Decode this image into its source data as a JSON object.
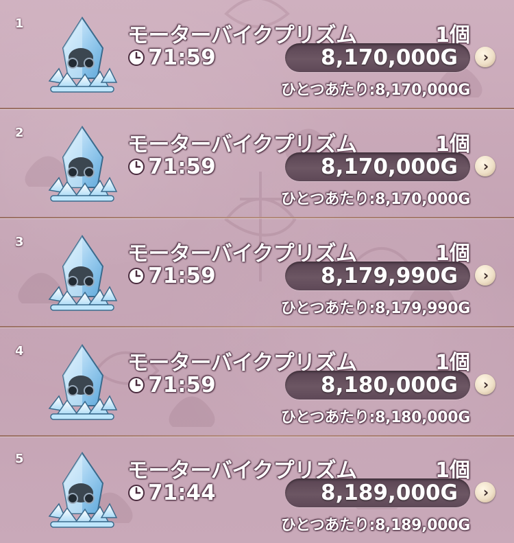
{
  "listings": [
    {
      "index": "1",
      "item_name": "モーターバイクプリズム",
      "quantity": "1個",
      "time_remaining": "71:59",
      "price": "8,170,000G",
      "unit_price": "ひとつあたり:8,170,000G",
      "icon": "motorbike-prism-crystal-icon"
    },
    {
      "index": "2",
      "item_name": "モーターバイクプリズム",
      "quantity": "1個",
      "time_remaining": "71:59",
      "price": "8,170,000G",
      "unit_price": "ひとつあたり:8,170,000G",
      "icon": "motorbike-prism-crystal-icon"
    },
    {
      "index": "3",
      "item_name": "モーターバイクプリズム",
      "quantity": "1個",
      "time_remaining": "71:59",
      "price": "8,179,990G",
      "unit_price": "ひとつあたり:8,179,990G",
      "icon": "motorbike-prism-crystal-icon"
    },
    {
      "index": "4",
      "item_name": "モーターバイクプリズム",
      "quantity": "1個",
      "time_remaining": "71:59",
      "price": "8,180,000G",
      "unit_price": "ひとつあたり:8,180,000G",
      "icon": "motorbike-prism-crystal-icon"
    },
    {
      "index": "5",
      "item_name": "モーターバイクプリズム",
      "quantity": "1個",
      "time_remaining": "71:44",
      "price": "8,189,000G",
      "unit_price": "ひとつあたり:8,189,000G",
      "icon": "motorbike-prism-crystal-icon"
    }
  ],
  "colors": {
    "background": "#c7a6b6",
    "price_pill": "#5e4857",
    "text": "#ffffff",
    "separator": "#9a6f63"
  },
  "detail_icon": "chevron-right-icon",
  "time_icon": "clock-icon"
}
